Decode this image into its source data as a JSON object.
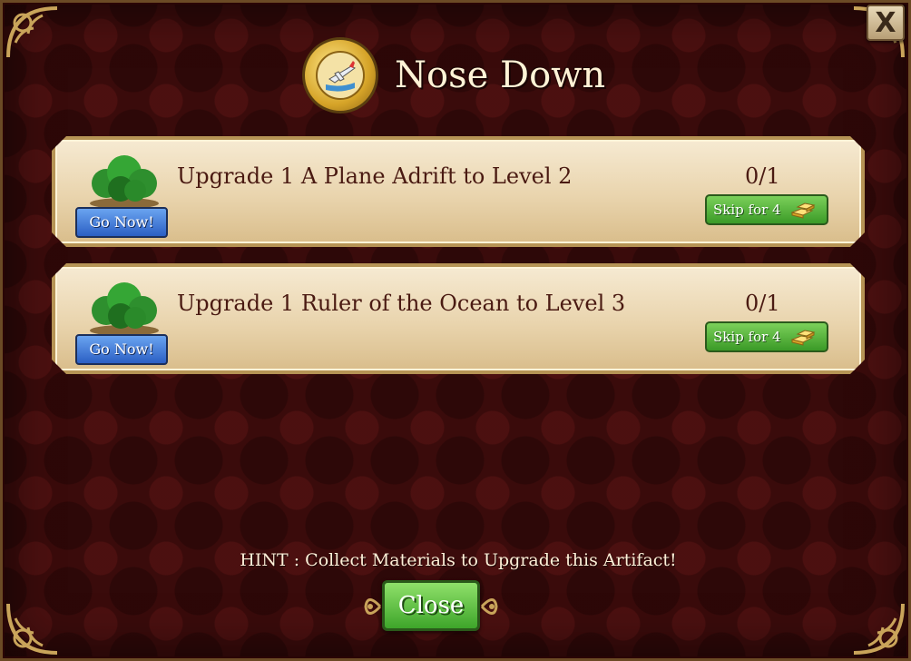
{
  "dialog": {
    "title": "Nose Down",
    "close_icon_label": "X",
    "icons": {
      "medal": "airplane-artifact-medal-icon",
      "tree": "tree-cluster-icon",
      "gold": "gold-bars-icon",
      "corner": "ornate-corner-icon"
    },
    "colors": {
      "background": "#3a0b0b",
      "panel": "#f0e2c4",
      "go_button": "#3a74d8",
      "skip_button": "#4cae33",
      "text": "#4a1a12"
    }
  },
  "tasks": [
    {
      "description": "Upgrade 1 A Plane Adrift to Level 2",
      "go_label": "Go Now!",
      "progress": "0/1",
      "skip_label": "Skip for 4"
    },
    {
      "description": "Upgrade 1 Ruler of the Ocean to Level 3",
      "go_label": "Go Now!",
      "progress": "0/1",
      "skip_label": "Skip for 4"
    }
  ],
  "footer": {
    "hint": "HINT : Collect Materials to Upgrade this Artifact!",
    "close_label": "Close"
  }
}
